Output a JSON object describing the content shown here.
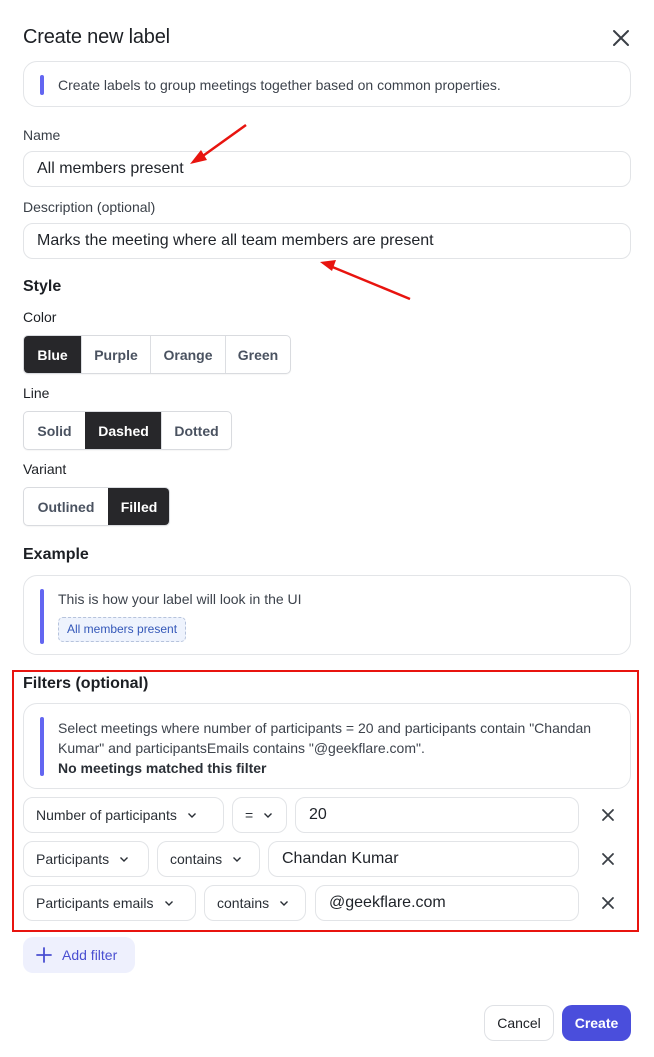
{
  "dialog": {
    "title": "Create new label",
    "close_icon": "close-icon",
    "info_text": "Create labels to group meetings together based on common properties."
  },
  "form": {
    "name_label": "Name",
    "name_value": "All members present",
    "description_label": "Description (optional)",
    "description_value": "Marks the meeting where all team members are present"
  },
  "style": {
    "title": "Style",
    "color": {
      "label": "Color",
      "options": [
        "Blue",
        "Purple",
        "Orange",
        "Green"
      ],
      "selected": "Blue"
    },
    "line": {
      "label": "Line",
      "options": [
        "Solid",
        "Dashed",
        "Dotted"
      ],
      "selected": "Dashed"
    },
    "variant": {
      "label": "Variant",
      "options": [
        "Outlined",
        "Filled"
      ],
      "selected": "Filled"
    }
  },
  "example": {
    "title": "Example",
    "text": "This is how your label will look in the UI",
    "chip_label": "All members present"
  },
  "filters": {
    "title": "Filters (optional)",
    "summary": "Select meetings where number of participants = 20 and participants contain \"Chandan Kumar\" and participantsEmails contains \"@geekflare.com\".",
    "match_status": "No meetings matched this filter",
    "rows": [
      {
        "field": "Number of participants",
        "operator": "=",
        "value": "20"
      },
      {
        "field": "Participants",
        "operator": "contains",
        "value": "Chandan Kumar"
      },
      {
        "field": "Participants emails",
        "operator": "contains",
        "value": "@geekflare.com"
      }
    ],
    "add_label": "Add filter"
  },
  "footer": {
    "cancel_label": "Cancel",
    "create_label": "Create"
  },
  "colors": {
    "accent": "#4a4edc",
    "callout_bar": "#6366f1",
    "selected_segment": "#27272a",
    "annotation_red": "#e8140f",
    "chip_background": "#eef3fd",
    "chip_text": "#3357b8"
  }
}
